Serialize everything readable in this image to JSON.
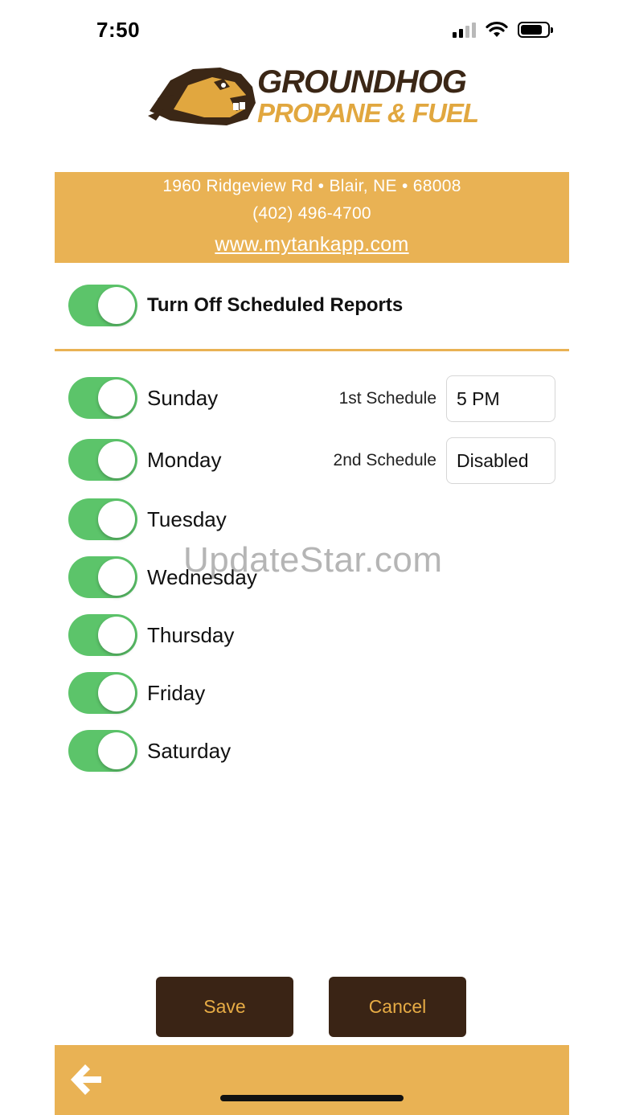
{
  "status_bar": {
    "time": "7:50"
  },
  "logo": {
    "line1": "GROUNDHOG",
    "line2": "PROPANE & FUEL"
  },
  "banner": {
    "address": "1960 Ridgeview Rd • Blair, NE • 68008",
    "phone": "(402) 496-4700",
    "website": "www.mytankapp.com"
  },
  "master_toggle": {
    "label": "Turn Off Scheduled Reports",
    "on": true
  },
  "days": [
    {
      "label": "Sunday",
      "on": true
    },
    {
      "label": "Monday",
      "on": true
    },
    {
      "label": "Tuesday",
      "on": true
    },
    {
      "label": "Wednesday",
      "on": true
    },
    {
      "label": "Thursday",
      "on": true
    },
    {
      "label": "Friday",
      "on": true
    },
    {
      "label": "Saturday",
      "on": true
    }
  ],
  "schedules": [
    {
      "label": "1st Schedule",
      "value": "5 PM"
    },
    {
      "label": "2nd Schedule",
      "value": "Disabled"
    }
  ],
  "watermark": "UpdateStar.com",
  "buttons": {
    "save": "Save",
    "cancel": "Cancel"
  },
  "colors": {
    "accent_gold": "#e9b254",
    "dark_brown": "#3a2415",
    "toggle_green": "#5cc46a"
  },
  "icons": {
    "back": "arrow-left-icon"
  }
}
